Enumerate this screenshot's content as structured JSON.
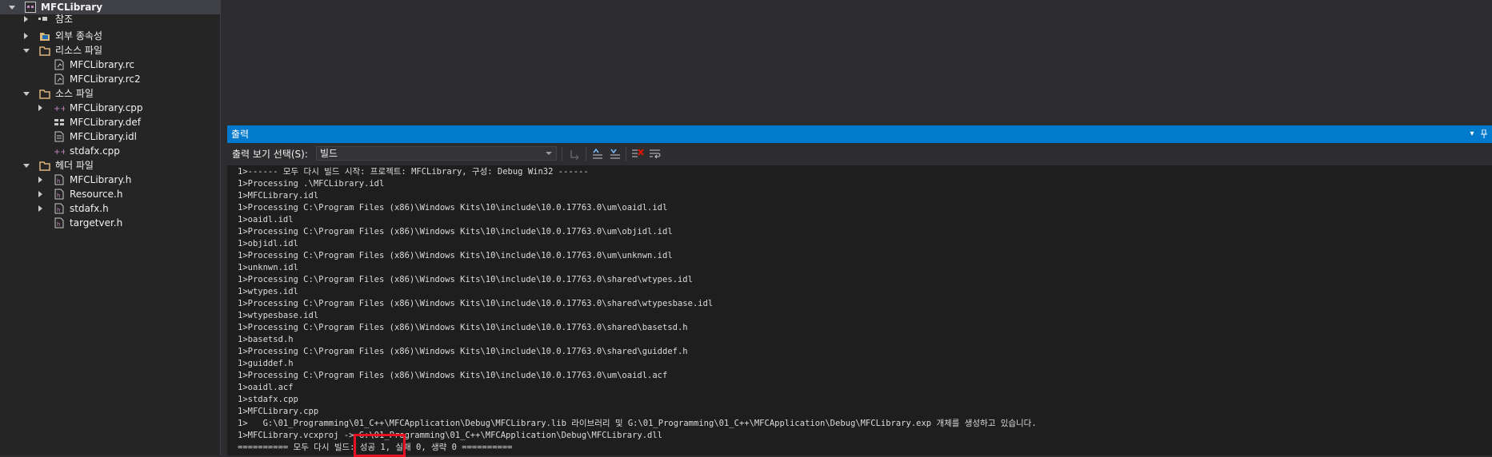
{
  "solution_explorer": {
    "items": [
      {
        "label": "MFCLibrary",
        "icon": "vc-project-icon"
      },
      {
        "label": "참조",
        "icon": "references-icon"
      },
      {
        "label": "외부 종속성",
        "icon": "external-dependencies-icon"
      },
      {
        "label": "리소스 파일",
        "icon": "folder-icon"
      },
      {
        "label": "MFCLibrary.rc",
        "icon": "resource-file-icon"
      },
      {
        "label": "MFCLibrary.rc2",
        "icon": "resource-file-icon"
      },
      {
        "label": "소스 파일",
        "icon": "folder-icon"
      },
      {
        "label": "MFCLibrary.cpp",
        "icon": "cpp-file-icon"
      },
      {
        "label": "MFCLibrary.def",
        "icon": "def-file-icon"
      },
      {
        "label": "MFCLibrary.idl",
        "icon": "idl-file-icon"
      },
      {
        "label": "stdafx.cpp",
        "icon": "cpp-file-icon"
      },
      {
        "label": "헤더 파일",
        "icon": "folder-icon"
      },
      {
        "label": "MFCLibrary.h",
        "icon": "header-file-icon"
      },
      {
        "label": "Resource.h",
        "icon": "header-file-icon"
      },
      {
        "label": "stdafx.h",
        "icon": "header-file-icon"
      },
      {
        "label": "targetver.h",
        "icon": "header-file-icon"
      }
    ]
  },
  "output": {
    "title": "출력",
    "source_label": "출력 보기 선택(S):",
    "source_value": "빌드",
    "lines": [
      "1>------ 모두 다시 빌드 시작: 프로젝트: MFCLibrary, 구성: Debug Win32 ------",
      "1>Processing .\\MFCLibrary.idl",
      "1>MFCLibrary.idl",
      "1>Processing C:\\Program Files (x86)\\Windows Kits\\10\\include\\10.0.17763.0\\um\\oaidl.idl",
      "1>oaidl.idl",
      "1>Processing C:\\Program Files (x86)\\Windows Kits\\10\\include\\10.0.17763.0\\um\\objidl.idl",
      "1>objidl.idl",
      "1>Processing C:\\Program Files (x86)\\Windows Kits\\10\\include\\10.0.17763.0\\um\\unknwn.idl",
      "1>unknwn.idl",
      "1>Processing C:\\Program Files (x86)\\Windows Kits\\10\\include\\10.0.17763.0\\shared\\wtypes.idl",
      "1>wtypes.idl",
      "1>Processing C:\\Program Files (x86)\\Windows Kits\\10\\include\\10.0.17763.0\\shared\\wtypesbase.idl",
      "1>wtypesbase.idl",
      "1>Processing C:\\Program Files (x86)\\Windows Kits\\10\\include\\10.0.17763.0\\shared\\basetsd.h",
      "1>basetsd.h",
      "1>Processing C:\\Program Files (x86)\\Windows Kits\\10\\include\\10.0.17763.0\\shared\\guiddef.h",
      "1>guiddef.h",
      "1>Processing C:\\Program Files (x86)\\Windows Kits\\10\\include\\10.0.17763.0\\um\\oaidl.acf",
      "1>oaidl.acf",
      "1>stdafx.cpp",
      "1>MFCLibrary.cpp",
      "1>   G:\\01_Programming\\01_C++\\MFCApplication\\Debug\\MFCLibrary.lib 라이브러리 및 G:\\01_Programming\\01_C++\\MFCApplication\\Debug\\MFCLibrary.exp 개체를 생성하고 있습니다.",
      "1>MFCLibrary.vcxproj -> G:\\01_Programming\\01_C++\\MFCApplication\\Debug\\MFCLibrary.dll",
      "========== 모두 다시 빌드: 성공 1, 실패 0, 생략 0 =========="
    ]
  },
  "colors": {
    "accent": "#007acc",
    "highlight": "#e81123",
    "background": "#1e1e1e"
  }
}
